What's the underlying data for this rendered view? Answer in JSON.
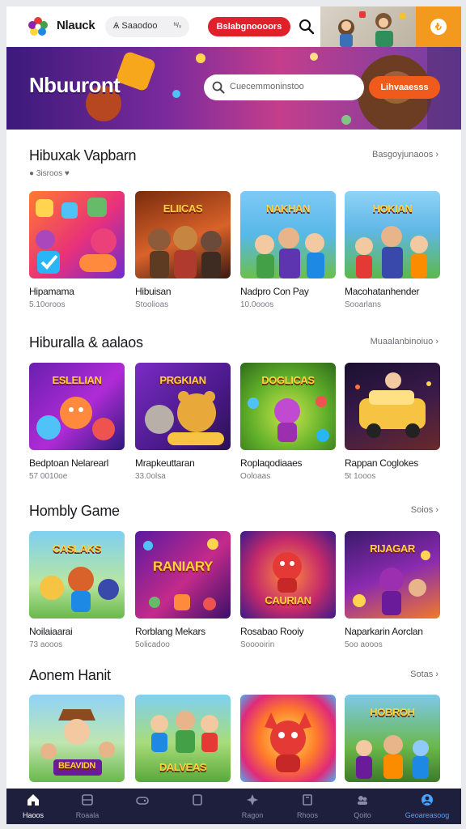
{
  "header": {
    "brand": "Nlauck",
    "search_pill": "Ѧ Saaodoo",
    "search_tag": "ᴺ/ᵥ",
    "cta_label": "Bslabgnoooors",
    "coin_symbol": "₺"
  },
  "hero": {
    "title": "Nbuuront",
    "search_placeholder": "Cuecemmoninstoo",
    "cta_label": "Lihvaaesss"
  },
  "sections": [
    {
      "title": "Hibuxak Vapbarn",
      "link": "Basgoyjunaoos",
      "subline": "3isroos",
      "cards": [
        {
          "name": "Hipamama",
          "meta": "5.10oroos",
          "art": "Candy"
        },
        {
          "name": "Hibuisan",
          "meta": "Stoolioas",
          "art": "ELIICAS"
        },
        {
          "name": "Nadpro Con Pay",
          "meta": "10.0ooos",
          "art": "NAKHAN"
        },
        {
          "name": "Macohatanhender",
          "meta": "Sooarlans",
          "art": "HOKIAN"
        }
      ]
    },
    {
      "title": "Hiburalla & aalaos",
      "link": "Muaalanbinoiuo",
      "subline": "",
      "cards": [
        {
          "name": "Bedptoan Nelarearl",
          "meta": "57 0010oe",
          "art": "ESLELIAN"
        },
        {
          "name": "Mrapkeuttaran",
          "meta": "33.0olsa",
          "art": "PRGKIAN"
        },
        {
          "name": "Roplaqodiaaes",
          "meta": "Ooloaas",
          "art": "DOGLICAS"
        },
        {
          "name": "Rappan Coglokes",
          "meta": "5t 1ooos",
          "art": ""
        }
      ]
    },
    {
      "title": "Hombly Game",
      "link": "Soios",
      "subline": "",
      "cards": [
        {
          "name": "Noilaiaarai",
          "meta": "73 aooos",
          "art": "CASLAKS"
        },
        {
          "name": "Rorblang Mekars",
          "meta": "5olicadoo",
          "art": "RANIARY"
        },
        {
          "name": "Rosabao Rooiy",
          "meta": "Sooooirin",
          "art": "CAURIAN"
        },
        {
          "name": "Naparkarin Aorclan",
          "meta": "5oo aooos",
          "art": "RIJAGAR"
        }
      ]
    },
    {
      "title": "Aonem Hanit",
      "link": "Sotas",
      "subline": "",
      "cards": [
        {
          "name": "",
          "meta": "",
          "art": "BEAVIDN"
        },
        {
          "name": "",
          "meta": "",
          "art": "DALVEAS"
        },
        {
          "name": "",
          "meta": "",
          "art": ""
        },
        {
          "name": "",
          "meta": "",
          "art": "HOBROH"
        }
      ]
    }
  ],
  "bottom_nav": [
    {
      "label": "Haoos",
      "icon": "home-icon"
    },
    {
      "label": "Roaala",
      "icon": "grid-icon"
    },
    {
      "label": "",
      "icon": "gamepad-icon"
    },
    {
      "label": "",
      "icon": "box-icon"
    },
    {
      "label": "Ragon",
      "icon": "spark-icon"
    },
    {
      "label": "Rhoos",
      "icon": "book-icon"
    },
    {
      "label": "Qoito",
      "icon": "users-icon"
    },
    {
      "label": "Geoareasoog",
      "icon": "profile-icon"
    }
  ]
}
